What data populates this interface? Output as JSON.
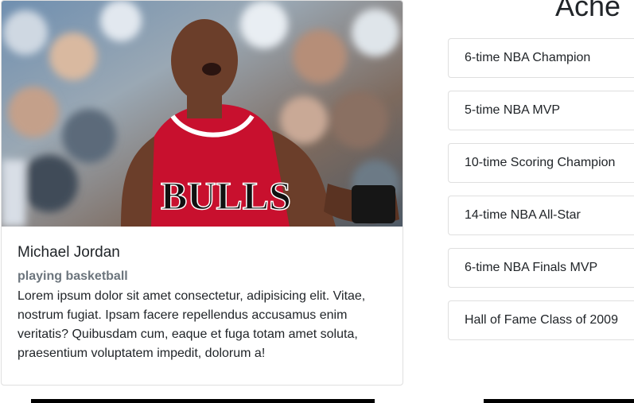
{
  "profile": {
    "image_alt": "Michael Jordan",
    "name": "Michael Jordan",
    "subtitle": "playing basketball",
    "bio": "Lorem ipsum dolor sit amet consectetur, adipisicing elit. Vitae, nostrum fugiat. Ipsam facere repellendus accusamus enim veritatis? Quibusdam cum, eaque et fuga totam amet soluta, praesentium voluptatem impedit, dolorum a!",
    "jersey_text": "BULLS"
  },
  "achievements": {
    "heading": "Ache",
    "items": [
      {
        "label": "6-time NBA Champion"
      },
      {
        "label": "5-time NBA MVP"
      },
      {
        "label": "10-time Scoring Champion"
      },
      {
        "label": "14-time NBA All-Star"
      },
      {
        "label": "6-time NBA Finals MVP"
      },
      {
        "label": "Hall of Fame Class of 2009"
      }
    ]
  },
  "colors": {
    "subtitle": "#6c757d",
    "border": "rgba(0,0,0,0.125)",
    "jersey_red": "#c8102e"
  }
}
